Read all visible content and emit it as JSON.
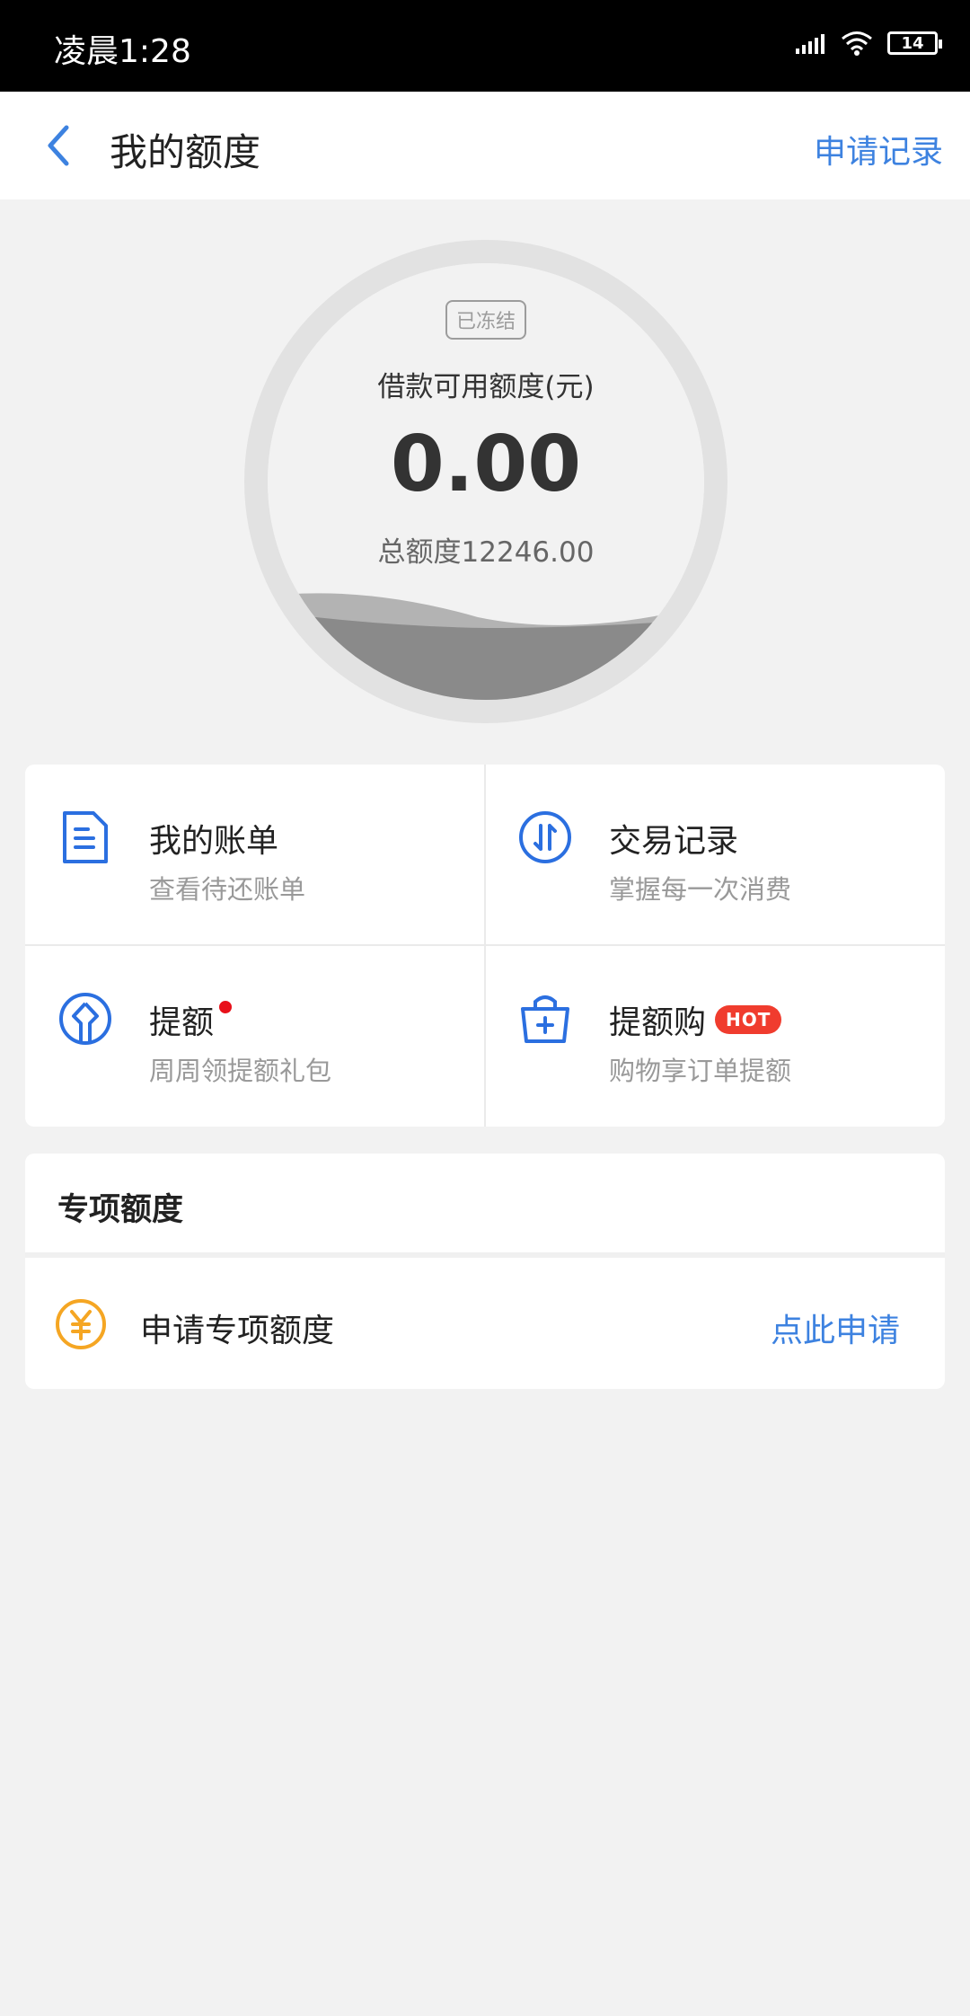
{
  "status_bar": {
    "time": "凌晨1:28",
    "battery": "14",
    "icons": [
      "signal-icon",
      "wifi-icon",
      "battery-icon"
    ]
  },
  "header": {
    "title": "我的额度",
    "right_link": "申请记录",
    "back_icon": "chevron-left-icon"
  },
  "credit": {
    "status_badge": "已冻结",
    "available_label": "借款可用额度(元)",
    "available_amount": "0.00",
    "total_label": "总额度12246.00"
  },
  "menu": [
    {
      "title": "我的账单",
      "subtitle": "查看待还账单",
      "icon": "bill-icon"
    },
    {
      "title": "交易记录",
      "subtitle": "掌握每一次消费",
      "icon": "transfer-icon"
    },
    {
      "title": "提额",
      "subtitle": "周周领提额礼包",
      "icon": "raise-limit-icon",
      "dot": true
    },
    {
      "title": "提额购",
      "subtitle": "购物享订单提额",
      "icon": "shopping-bag-icon",
      "badge": "HOT"
    }
  ],
  "special": {
    "section_title": "专项额度",
    "item_label": "申请专项额度",
    "action_label": "点此申请",
    "icon": "yuan-coin-icon"
  },
  "colors": {
    "accent": "#3d82e0",
    "hot_badge": "#f03c2e",
    "coin": "#f5a623",
    "background": "#f2f2f2"
  }
}
